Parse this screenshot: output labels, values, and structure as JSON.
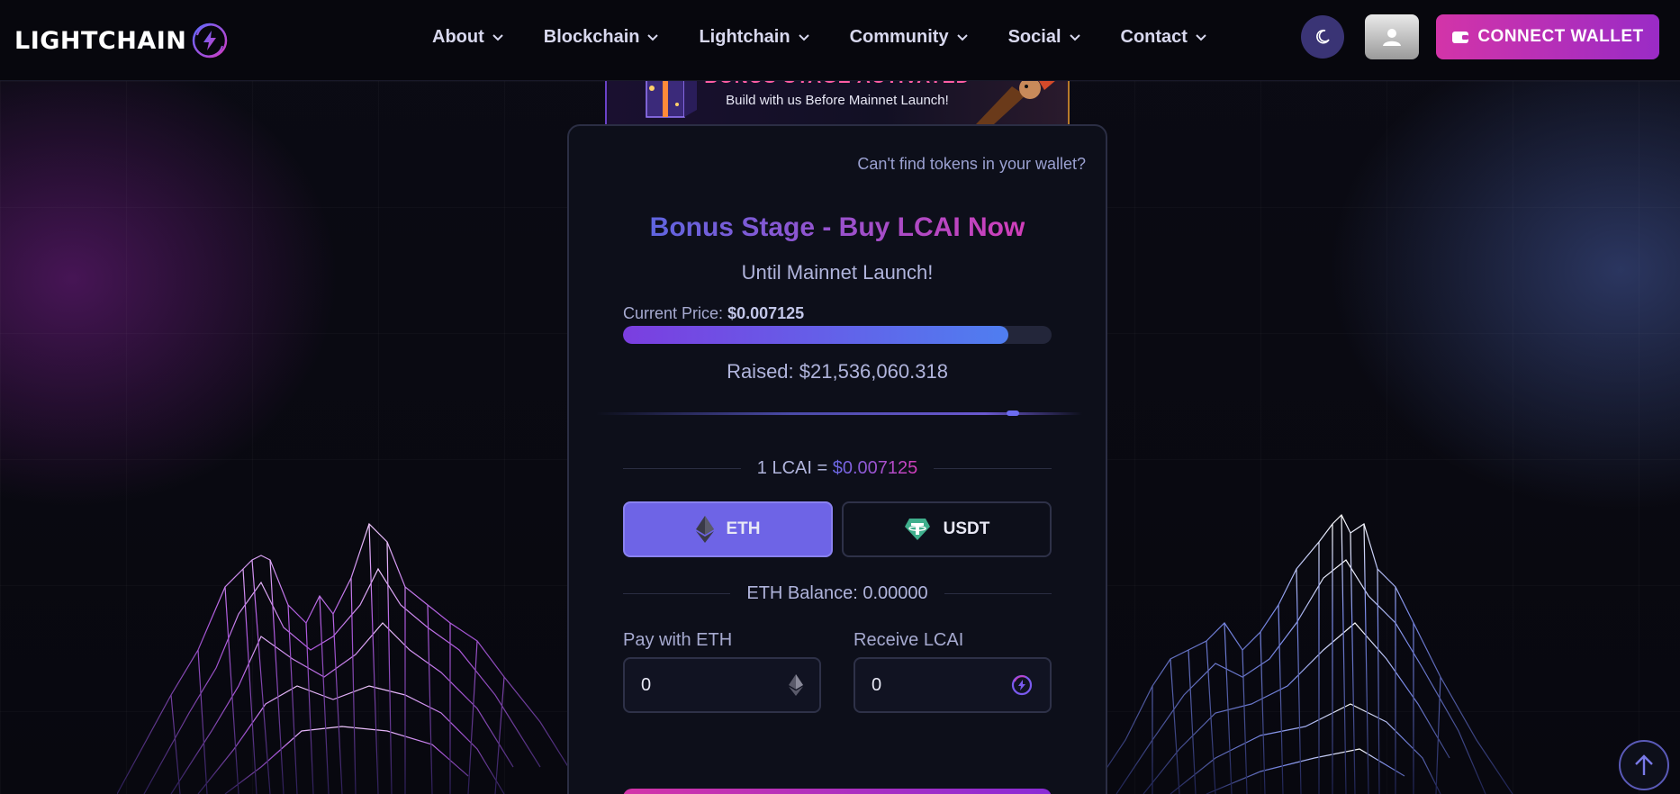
{
  "brand": {
    "name": "LIGHTCHAIN"
  },
  "nav": {
    "items": [
      {
        "label": "About"
      },
      {
        "label": "Blockchain"
      },
      {
        "label": "Lightchain"
      },
      {
        "label": "Community"
      },
      {
        "label": "Social"
      },
      {
        "label": "Contact"
      }
    ],
    "connect_label": "CONNECT WALLET"
  },
  "banner": {
    "title": "BONUS STAGE ACTIVATED",
    "subtitle": "Build with us Before Mainnet Launch!"
  },
  "presale": {
    "help_link": "Can't find tokens in your wallet?",
    "title": "Bonus Stage - Buy LCAI Now",
    "subtitle": "Until Mainnet Launch!",
    "price_label": "Current Price:",
    "price_value": "$0.007125",
    "progress_fraction": 0.9,
    "raised": "Raised: $21,536,060.318",
    "rate_prefix": "1 LCAI = ",
    "rate_value": "$0.007125",
    "tokens": [
      {
        "label": "ETH",
        "icon": "ethereum-icon",
        "active": true
      },
      {
        "label": "USDT",
        "icon": "tether-icon",
        "active": false
      }
    ],
    "balance": "ETH Balance: 0.00000",
    "pay_label": "Pay with ETH",
    "pay_value": "0",
    "receive_label": "Receive LCAI",
    "receive_value": "0"
  },
  "colors": {
    "accent": "#6e64e6",
    "cta": "#d334a8",
    "background": "#07070d"
  }
}
